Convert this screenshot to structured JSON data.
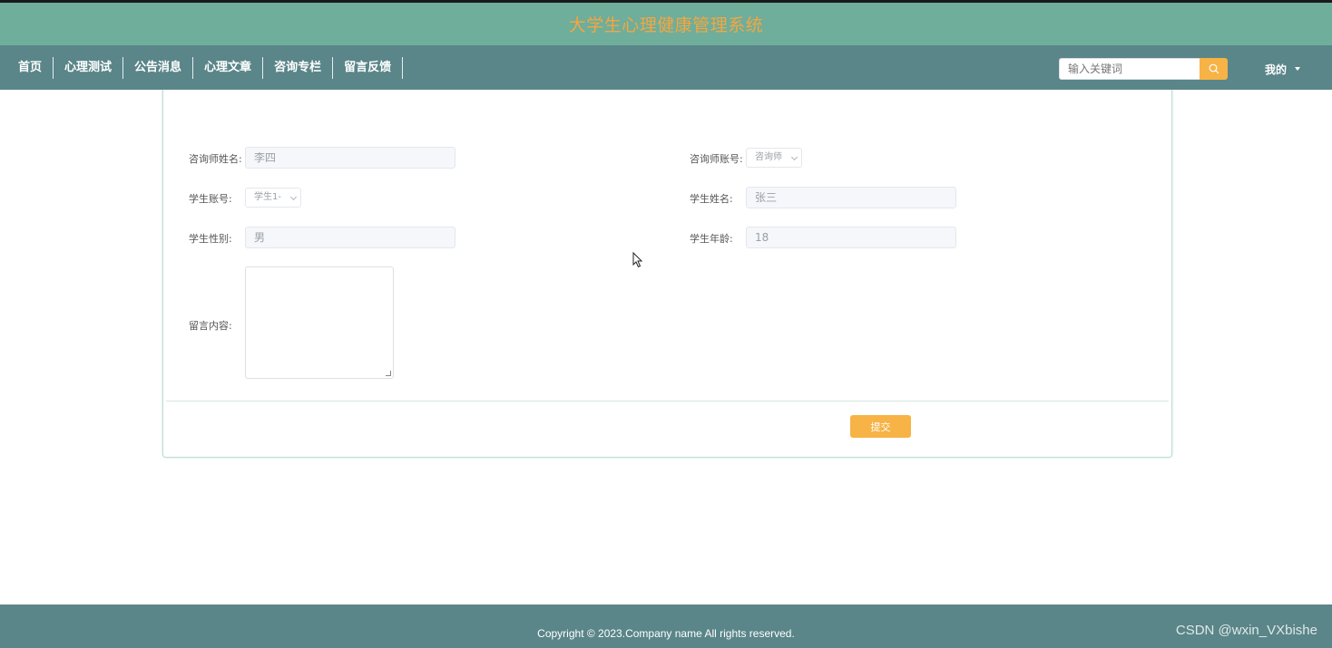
{
  "header": {
    "title": "大学生心理健康管理系统"
  },
  "nav": {
    "items": [
      "首页",
      "心理测试",
      "公告消息",
      "心理文章",
      "咨询专栏",
      "留言反馈"
    ],
    "search_placeholder": "输入关键词",
    "user_label": "我的"
  },
  "form": {
    "counselor_name_label": "咨询师姓名:",
    "counselor_name_value": "李四",
    "counselor_account_label": "咨询师账号:",
    "counselor_account_value": "咨询师",
    "student_account_label": "学生账号:",
    "student_account_value": "学生1-",
    "student_name_label": "学生姓名:",
    "student_name_value": "张三",
    "student_gender_label": "学生性别:",
    "student_gender_value": "男",
    "student_age_label": "学生年龄:",
    "student_age_value": "18",
    "message_label": "留言内容:",
    "submit_label": "提交"
  },
  "footer": {
    "copyright": "Copyright © 2023.Company name All rights reserved.",
    "watermark": "CSDN @wxin_VXbishe"
  },
  "colors": {
    "header_bg": "#6eae9b",
    "nav_bg": "#5a8589",
    "accent": "#f7b345",
    "title_color": "#f5a640"
  }
}
